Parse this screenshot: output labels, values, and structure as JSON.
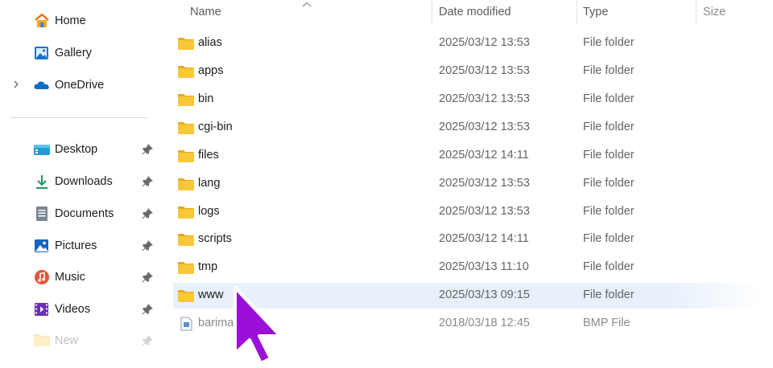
{
  "sidebar": {
    "items": [
      {
        "label": "Home",
        "icon": "home-icon"
      },
      {
        "label": "Gallery",
        "icon": "gallery-icon"
      },
      {
        "label": "OneDrive",
        "icon": "cloud-icon",
        "expandable": true
      },
      {
        "label": "Desktop",
        "icon": "desktop-icon",
        "pinned": true
      },
      {
        "label": "Downloads",
        "icon": "download-icon",
        "pinned": true
      },
      {
        "label": "Documents",
        "icon": "document-icon",
        "pinned": true
      },
      {
        "label": "Pictures",
        "icon": "pictures-icon",
        "pinned": true
      },
      {
        "label": "Music",
        "icon": "music-icon",
        "pinned": true
      },
      {
        "label": "Videos",
        "icon": "videos-icon",
        "pinned": true
      },
      {
        "label": "New",
        "icon": "folder-icon",
        "pinned": true
      }
    ]
  },
  "file_list": {
    "columns": {
      "name": "Name",
      "date_modified": "Date modified",
      "type": "Type",
      "size": "Size"
    },
    "sort_indicator": "caret-up-icon",
    "rows": [
      {
        "name": "alias",
        "date": "2025/03/12 13:53",
        "type": "File folder"
      },
      {
        "name": "apps",
        "date": "2025/03/12 13:53",
        "type": "File folder"
      },
      {
        "name": "bin",
        "date": "2025/03/12 13:53",
        "type": "File folder"
      },
      {
        "name": "cgi-bin",
        "date": "2025/03/12 13:53",
        "type": "File folder"
      },
      {
        "name": "files",
        "date": "2025/03/12 14:11",
        "type": "File folder"
      },
      {
        "name": "lang",
        "date": "2025/03/12 13:53",
        "type": "File folder"
      },
      {
        "name": "logs",
        "date": "2025/03/12 13:53",
        "type": "File folder"
      },
      {
        "name": "scripts",
        "date": "2025/03/12 14:11",
        "type": "File folder"
      },
      {
        "name": "tmp",
        "date": "2025/03/13 11:10",
        "type": "File folder"
      },
      {
        "name": "www",
        "date": "2025/03/13 09:15",
        "type": "File folder",
        "selected": true
      },
      {
        "name": "barima",
        "date": "2018/03/18 12:45",
        "type": "BMP File",
        "icon": "bmp-file-icon"
      }
    ]
  },
  "colors": {
    "folder": "#f8c73a",
    "folder_dark": "#e8a91c",
    "selection": "#e8f1fb",
    "cursor": "#9b10d6"
  },
  "cursor_icon": "mouse-pointer-icon"
}
